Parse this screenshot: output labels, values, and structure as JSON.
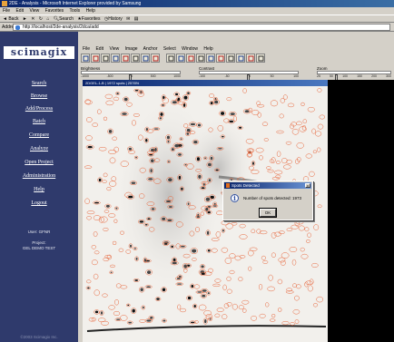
{
  "browser": {
    "title": "2DE - Analysis - Microsoft Internet Explorer provided by Samsung",
    "menu": [
      "File",
      "Edit",
      "View",
      "Favorites",
      "Tools",
      "Help"
    ],
    "toolbar": {
      "back": "Back",
      "search": "Search",
      "favorites": "Favorites",
      "history": "History",
      "go": "Go"
    },
    "address_label": "Address",
    "address_url": "http://localhost/2de-analysis/2dca/add"
  },
  "sidebar": {
    "logo": "scimagix",
    "nav": [
      "Search",
      "Browse",
      "Add/Process",
      "Batch",
      "Compare",
      "Analyze",
      "Open Project",
      "Administration",
      "Help",
      "Logout"
    ],
    "user": "User: GFNR",
    "project": "Project:",
    "project_name": "GEL DEMO TEST",
    "copyright": "©2003 Scimagix Inc."
  },
  "app": {
    "menu": [
      "File",
      "Edit",
      "View",
      "Image",
      "Anchor",
      "Select",
      "Window",
      "Help"
    ],
    "sliders": [
      {
        "label": "Brightness",
        "ticks": [
          "-1000",
          "-500",
          "0",
          "500",
          "1000"
        ],
        "value_fraction": 0.5
      },
      {
        "label": "Contrast",
        "ticks": [
          "-100",
          "-50",
          "0",
          "50",
          "100"
        ],
        "value_fraction": 0.5
      },
      {
        "label": "Zoom",
        "ticks": [
          "25",
          "50",
          "100",
          "150",
          "200",
          "300"
        ],
        "value_fraction": 0.25
      }
    ],
    "image_window_title": "2DGEL-1-B | 1972 spots | 2576%",
    "colors": {
      "spot_outline": "#e8653a",
      "sidebar": "#2f3a6c"
    }
  },
  "dialog": {
    "title": "Spots Detected",
    "close": "x",
    "message": "Number of spots detected: 1973",
    "ok": "OK"
  }
}
